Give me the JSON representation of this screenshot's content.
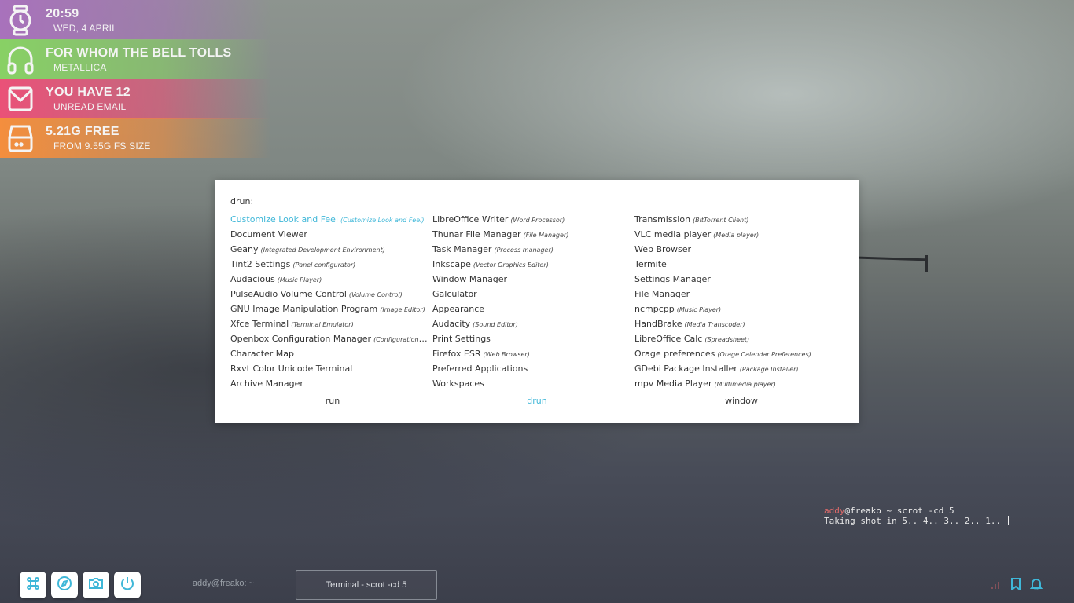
{
  "widgets": {
    "clock": {
      "big": "20:59",
      "small": "WED, 4 APRIL"
    },
    "music": {
      "big": "FOR WHOM THE BELL TOLLS",
      "small": "METALLICA"
    },
    "mail": {
      "big": "YOU HAVE 12",
      "small": "UNREAD EMAIL"
    },
    "disk": {
      "big": "5.21G FREE",
      "small": "FROM 9.55G FS SIZE"
    }
  },
  "rofi": {
    "prompt": "drun:",
    "accent_color": "#3fb7d8",
    "columns": [
      [
        {
          "name": "Customize Look and Feel",
          "comment": "(Customize Look and Feel)",
          "selected": true
        },
        {
          "name": "Document Viewer",
          "comment": ""
        },
        {
          "name": "Geany",
          "comment": "(Integrated Development Environment)"
        },
        {
          "name": "Tint2 Settings",
          "comment": "(Panel configurator)"
        },
        {
          "name": "Audacious",
          "comment": "(Music Player)"
        },
        {
          "name": "PulseAudio Volume Control",
          "comment": "(Volume Control)"
        },
        {
          "name": "GNU Image Manipulation Program",
          "comment": "(Image Editor)"
        },
        {
          "name": "Xfce Terminal",
          "comment": "(Terminal Emulator)"
        },
        {
          "name": "Openbox Configuration Manager",
          "comment": "(Configuration M..."
        },
        {
          "name": "Character Map",
          "comment": ""
        },
        {
          "name": "Rxvt Color Unicode Terminal",
          "comment": ""
        },
        {
          "name": "Archive Manager",
          "comment": ""
        }
      ],
      [
        {
          "name": "LibreOffice Writer",
          "comment": "(Word Processor)"
        },
        {
          "name": "Thunar File Manager",
          "comment": "(File Manager)"
        },
        {
          "name": "Task Manager",
          "comment": "(Process manager)"
        },
        {
          "name": "Inkscape",
          "comment": "(Vector Graphics Editor)"
        },
        {
          "name": "Window Manager",
          "comment": ""
        },
        {
          "name": "Galculator",
          "comment": ""
        },
        {
          "name": "Appearance",
          "comment": ""
        },
        {
          "name": "Audacity",
          "comment": "(Sound Editor)"
        },
        {
          "name": "Print Settings",
          "comment": ""
        },
        {
          "name": "Firefox ESR",
          "comment": "(Web Browser)"
        },
        {
          "name": "Preferred Applications",
          "comment": ""
        },
        {
          "name": "Workspaces",
          "comment": ""
        }
      ],
      [
        {
          "name": "Transmission",
          "comment": "(BitTorrent Client)"
        },
        {
          "name": "VLC media player",
          "comment": "(Media player)"
        },
        {
          "name": "Web Browser",
          "comment": ""
        },
        {
          "name": "Termite",
          "comment": ""
        },
        {
          "name": "Settings Manager",
          "comment": ""
        },
        {
          "name": "File Manager",
          "comment": ""
        },
        {
          "name": "ncmpcpp",
          "comment": "(Music Player)"
        },
        {
          "name": "HandBrake",
          "comment": "(Media Transcoder)"
        },
        {
          "name": "LibreOffice Calc",
          "comment": "(Spreadsheet)"
        },
        {
          "name": "Orage preferences",
          "comment": "(Orage Calendar Preferences)"
        },
        {
          "name": "GDebi Package Installer",
          "comment": "(Package Installer)"
        },
        {
          "name": "mpv Media Player",
          "comment": "(Multimedia player)"
        }
      ]
    ],
    "modes": [
      {
        "label": "run",
        "active": false
      },
      {
        "label": "drun",
        "active": true
      },
      {
        "label": "window",
        "active": false
      }
    ]
  },
  "terminal": {
    "user": "addy",
    "host_prompt": "@freako ~ scrot -cd 5",
    "output": "Taking shot in 5.. 4.. 3.. 2.. 1.. "
  },
  "taskbar": {
    "launchers": [
      "command-icon",
      "compass-icon",
      "camera-icon",
      "power-icon"
    ],
    "task_inactive": "addy@freako: ~",
    "task_active": "Terminal - scrot -cd 5",
    "tray": [
      "bookmark-icon",
      "bell-icon"
    ]
  }
}
